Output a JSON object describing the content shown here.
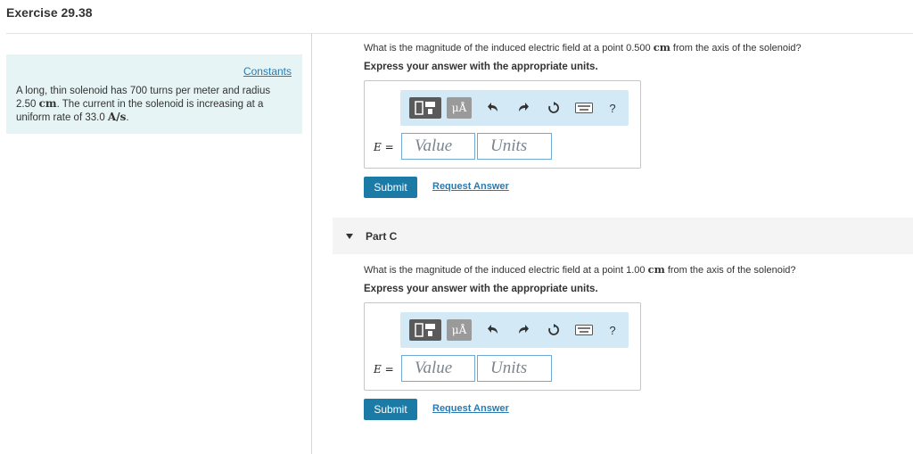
{
  "exercise_title": "Exercise 29.38",
  "problem": {
    "constants_label": "Constants",
    "text_part1": "A long, thin solenoid has 700 turns per meter and radius 2.50 ",
    "unit_cm": "cm",
    "text_part2": ". The current in the solenoid is increasing at a uniform rate of 33.0 ",
    "unit_rate": "A/s",
    "text_end": "."
  },
  "part_b": {
    "question_pre": "What is the magnitude of the induced electric field at a point 0.500 ",
    "question_unit": "cm",
    "question_post": " from the axis of the solenoid?",
    "instruction": "Express your answer with the appropriate units.",
    "variable": "E",
    "equals": " =",
    "value_placeholder": "Value",
    "units_placeholder": "Units",
    "unit_button": "μÅ",
    "help_label": "?",
    "submit_label": "Submit",
    "request_answer_label": "Request Answer"
  },
  "part_c": {
    "title": "Part C",
    "question_pre": "What is the magnitude of the induced electric field at a point 1.00 ",
    "question_unit": "cm",
    "question_post": " from the axis of the solenoid?",
    "instruction": "Express your answer with the appropriate units.",
    "variable": "E",
    "equals": " =",
    "value_placeholder": "Value",
    "units_placeholder": "Units",
    "unit_button": "μÅ",
    "help_label": "?",
    "submit_label": "Submit",
    "request_answer_label": "Request Answer"
  },
  "colors": {
    "accent": "#1c7aa6",
    "link": "#2a7ab0",
    "panel_bg": "#e7f4f5",
    "toolbar_bg": "#d4e9f6"
  },
  "icons": [
    "templates-icon",
    "undo-icon",
    "redo-icon",
    "reset-icon",
    "keyboard-icon",
    "help-icon",
    "caret-down-icon"
  ]
}
